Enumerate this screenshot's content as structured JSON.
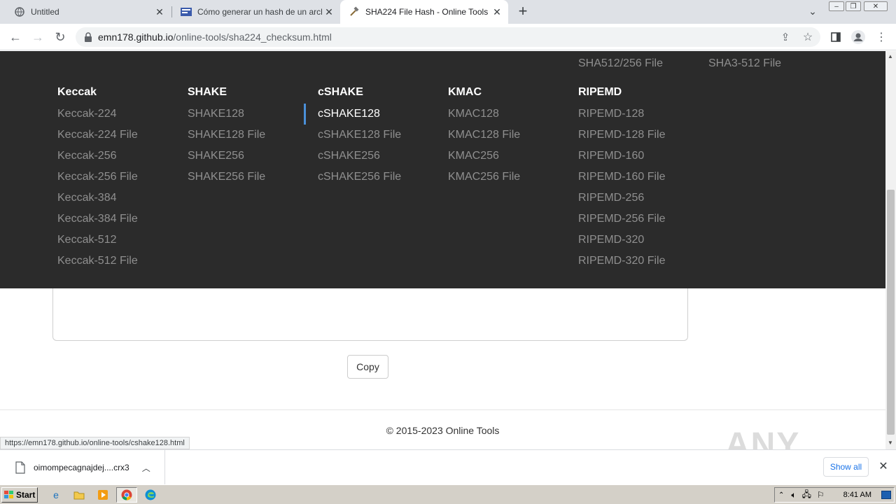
{
  "tabs": [
    {
      "title": "Untitled",
      "active": false
    },
    {
      "title": "Cómo generar un hash de un archivo",
      "active": false
    },
    {
      "title": "SHA224 File Hash - Online Tools",
      "active": true
    }
  ],
  "omnibox": {
    "host": "emn178.github.io",
    "path": "/online-tools/sha224_checksum.html"
  },
  "menu": {
    "top_items": [
      "SHA512/256 File",
      "SHA3-512 File"
    ],
    "columns": [
      {
        "heading": "Keccak",
        "items": [
          "Keccak-224",
          "Keccak-224 File",
          "Keccak-256",
          "Keccak-256 File",
          "Keccak-384",
          "Keccak-384 File",
          "Keccak-512",
          "Keccak-512 File"
        ]
      },
      {
        "heading": "SHAKE",
        "items": [
          "SHAKE128",
          "SHAKE128 File",
          "SHAKE256",
          "SHAKE256 File"
        ]
      },
      {
        "heading": "cSHAKE",
        "items": [
          "cSHAKE128",
          "cSHAKE128 File",
          "cSHAKE256",
          "cSHAKE256 File"
        ],
        "active_index": 0
      },
      {
        "heading": "KMAC",
        "items": [
          "KMAC128",
          "KMAC128 File",
          "KMAC256",
          "KMAC256 File"
        ]
      },
      {
        "heading": "RIPEMD",
        "items": [
          "RIPEMD-128",
          "RIPEMD-128 File",
          "RIPEMD-160",
          "RIPEMD-160 File",
          "RIPEMD-256",
          "RIPEMD-256 File",
          "RIPEMD-320",
          "RIPEMD-320 File"
        ]
      }
    ]
  },
  "page": {
    "copy_label": "Copy",
    "footer": "© 2015-2023 Online Tools",
    "status_url": "https://emn178.github.io/online-tools/cshake128.html",
    "watermark": "ANY RUN"
  },
  "download": {
    "filename": "oimompecagnajdej....crx3",
    "show_all": "Show all"
  },
  "taskbar": {
    "start": "Start",
    "clock": "8:41 AM"
  },
  "colors": {
    "menu_bg": "#2b2b2b",
    "active_bar": "#4a90d9",
    "link": "#1a73e8"
  }
}
